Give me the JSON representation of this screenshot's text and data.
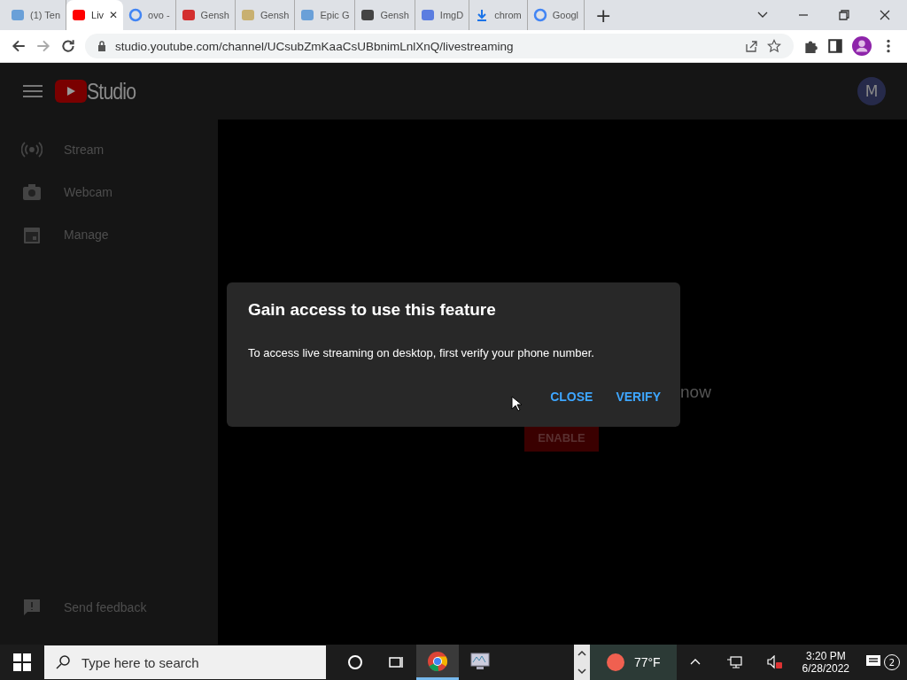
{
  "browser": {
    "tabs": [
      {
        "label": "(1) Ten",
        "kind": "mail",
        "selected": false
      },
      {
        "label": "Liv",
        "kind": "video",
        "selected": true
      },
      {
        "label": "ovo -",
        "kind": "g",
        "selected": false
      },
      {
        "label": "Gensh",
        "kind": "r",
        "selected": false
      },
      {
        "label": "Gensh",
        "kind": "picture",
        "selected": false
      },
      {
        "label": "Epic G",
        "kind": "mail",
        "selected": false
      },
      {
        "label": "Gensh",
        "kind": "dark",
        "selected": false
      },
      {
        "label": "ImgD",
        "kind": "cloud",
        "selected": false
      },
      {
        "label": "chrom",
        "kind": "download",
        "selected": false
      },
      {
        "label": "Googl",
        "kind": "g",
        "selected": false
      }
    ],
    "close_tab": "✕",
    "new_tab": "+",
    "url": "studio.youtube.com/channel/UCsubZmKaaCsUBbnimLnlXnQ/livestreaming"
  },
  "header": {
    "logo_text": "Studio",
    "avatar": "M"
  },
  "sidebar": {
    "items": [
      {
        "label": "Stream",
        "kind": "broadcast"
      },
      {
        "label": "Webcam",
        "kind": "camera"
      },
      {
        "label": "Manage",
        "kind": "calendar"
      }
    ],
    "feedback": "Send feedback"
  },
  "content": {
    "partial_text": "now",
    "enable_button": "ENABLE"
  },
  "dialog": {
    "title": "Gain access to use this feature",
    "message": "To access live streaming on desktop, first verify your phone number.",
    "buttons": [
      "CLOSE",
      "VERIFY"
    ]
  },
  "taskbar": {
    "search_placeholder": "Type here to search",
    "weather": "77°F",
    "time": "3:20 PM",
    "date": "6/28/2022",
    "notifications": "2"
  }
}
